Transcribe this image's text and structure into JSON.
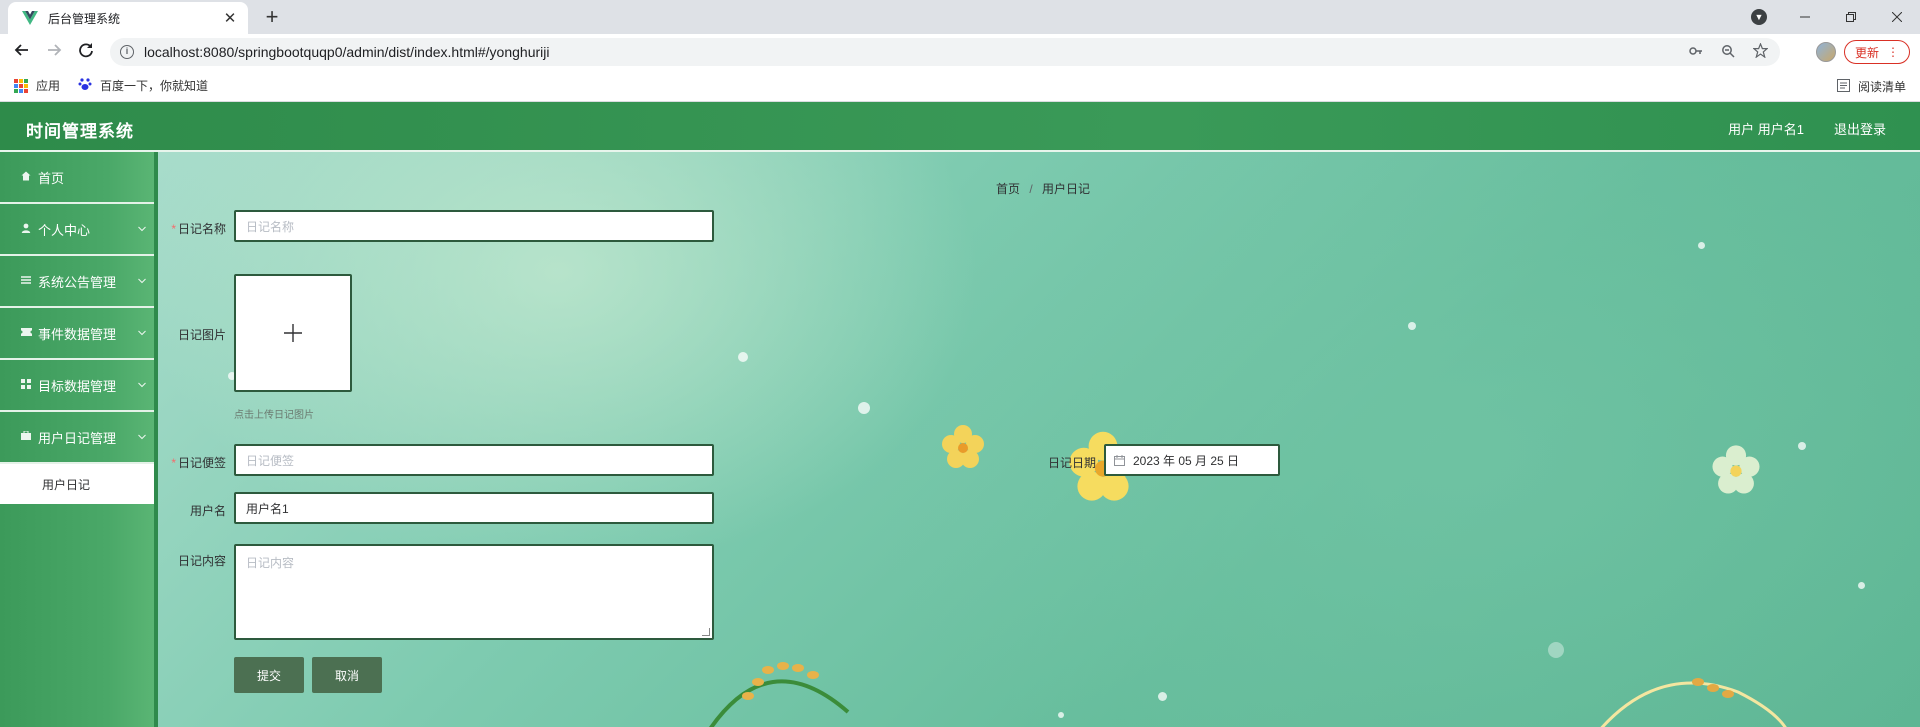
{
  "browser": {
    "tab_title": "后台管理系统",
    "tab_close": "✕",
    "new_tab": "+",
    "url": "localhost:8080/springbootquqp0/admin/dist/index.html#/yonghuriji",
    "update_label": "更新",
    "bookmarks": [
      {
        "label": "应用"
      },
      {
        "label": "百度一下，你就知道"
      }
    ],
    "reading_list": "阅读清单"
  },
  "app": {
    "brand": "时间管理系统",
    "user_info": "用户 用户名1",
    "logout": "退出登录"
  },
  "sidebar": {
    "items": [
      {
        "label": "首页",
        "icon": "home-icon",
        "has_arrow": false
      },
      {
        "label": "个人中心",
        "icon": "user-icon",
        "has_arrow": true
      },
      {
        "label": "系统公告管理",
        "icon": "list-icon",
        "has_arrow": true
      },
      {
        "label": "事件数据管理",
        "icon": "ticket-icon",
        "has_arrow": true
      },
      {
        "label": "目标数据管理",
        "icon": "grid-icon",
        "has_arrow": true
      },
      {
        "label": "用户日记管理",
        "icon": "briefcase-icon",
        "has_arrow": true
      }
    ],
    "active_sub": "用户日记"
  },
  "breadcrumb": {
    "home": "首页",
    "separator": "/",
    "current": "用户日记"
  },
  "form": {
    "name_label": "日记名称",
    "name_placeholder": "日记名称",
    "image_label": "日记图片",
    "upload_tip": "点击上传日记图片",
    "note_label": "日记便签",
    "note_placeholder": "日记便签",
    "date_label": "日记日期",
    "date_value": "2023 年 05 月 25 日",
    "username_label": "用户名",
    "username_value": "用户名1",
    "content_label": "日记内容",
    "content_placeholder": "日记内容",
    "required_mark": "*",
    "submit": "提交",
    "cancel": "取消"
  },
  "colors": {
    "header": "#2e8b4a",
    "sidebar": "#4aa868",
    "button": "#4c7052",
    "field_border": "#2d5a3d",
    "required": "#f56c6c"
  }
}
